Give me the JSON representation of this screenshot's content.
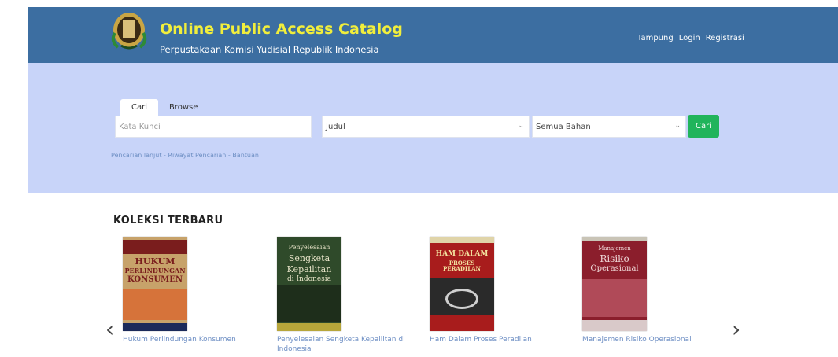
{
  "header": {
    "title": "Online Public Access Catalog",
    "subtitle": "Perpustakaan Komisi Yudisial Republik Indonesia",
    "nav": [
      "Tampung",
      "Login",
      "Registrasi"
    ]
  },
  "search": {
    "tabs": [
      "Cari",
      "Browse"
    ],
    "keyword_placeholder": "Kata Kunci",
    "field_selected": "Judul",
    "type_selected": "Semua Bahan",
    "button_label": "Cari",
    "links": [
      "Pencarian lanjut",
      "Riwayat Pencarian",
      "Bantuan"
    ]
  },
  "collection": {
    "heading": "KOLEKSI TERBARU",
    "books": [
      {
        "title": "Hukum Perlindungan Konsumen",
        "cover_lines": [
          "HUKUM",
          "PERLINDUNGAN",
          "KONSUMEN"
        ],
        "cover_color": "#c7a26a"
      },
      {
        "title": "Penyelesaian Sengketa Kepailitan di Indonesia",
        "cover_lines": [
          "Penyelesaian",
          "Sengketa",
          "Kepailitan",
          "di Indonesia"
        ],
        "cover_color": "#2f4a2a"
      },
      {
        "title": "Ham Dalam Proses Peradilan",
        "cover_lines": [
          "HAM DALAM",
          "PROSES PERADILAN"
        ],
        "cover_color": "#a81c1c"
      },
      {
        "title": "Manajemen Risiko Operasional",
        "cover_lines": [
          "Manajemen",
          "Risiko",
          "Operasional"
        ],
        "cover_color": "#8b1e2c"
      }
    ]
  },
  "colors": {
    "header_bg": "#3c6ea1",
    "title_yellow": "#f1ee3c",
    "panel_bg": "#c8d4f9",
    "button_green": "#21b45b",
    "link_blue": "#6e8fc4"
  },
  "icons": {
    "logo": "seal-emblem-icon",
    "select_arrow": "chevron-down-icon",
    "prev": "chevron-left-icon",
    "next": "chevron-right-icon"
  }
}
